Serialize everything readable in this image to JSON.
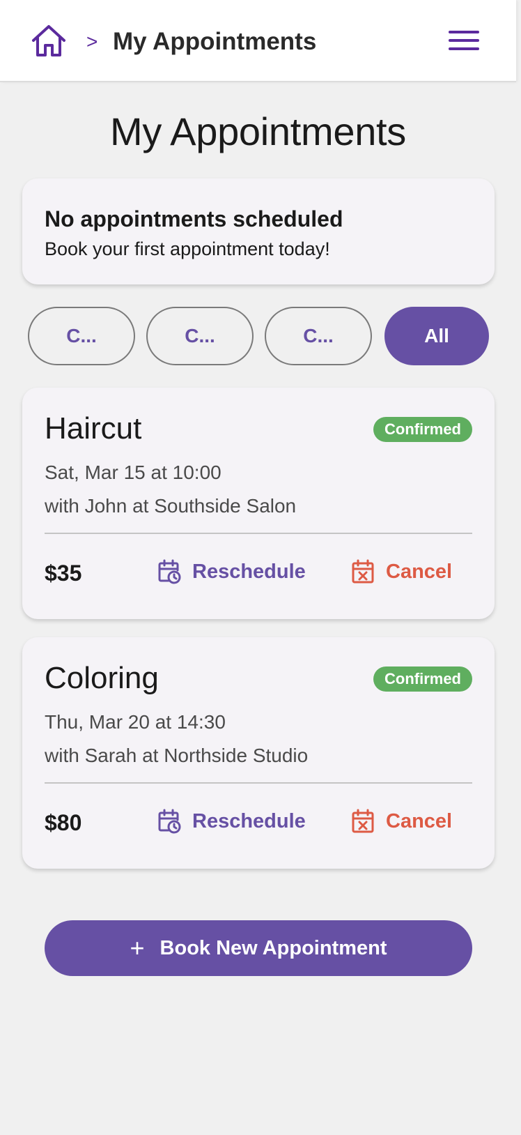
{
  "header": {
    "separator": ">",
    "title": "My Appointments",
    "home_icon": "home-icon",
    "menu_icon": "hamburger-menu-icon"
  },
  "main": {
    "title": "My Appointments",
    "notice": {
      "title": "No appointments scheduled",
      "text": "Book your first appointment today!"
    },
    "filters": [
      "C...",
      "C...",
      "C...",
      "All"
    ],
    "active_filter": "All",
    "appointments": [
      {
        "service": "Haircut",
        "status": "Confirmed",
        "when": "Sat, Mar 15 at 10:00",
        "with": "with John at Southside Salon",
        "price": "$35",
        "reschedule_label": "Reschedule",
        "cancel_label": "Cancel"
      },
      {
        "service": "Coloring",
        "status": "Confirmed",
        "when": "Thu, Mar 20 at 14:30",
        "with": "with Sarah at Northside Studio",
        "price": "$80",
        "reschedule_label": "Reschedule",
        "cancel_label": "Cancel"
      }
    ],
    "book_button": {
      "icon": "+",
      "label": "Book New Appointment"
    }
  },
  "colors": {
    "primary": "#6650a4",
    "header_accent": "#5b2a9d",
    "confirmed": "#5fae5f",
    "cancel": "#dd5a44",
    "background": "#f0f0f0",
    "card": "#f5f3f7"
  }
}
